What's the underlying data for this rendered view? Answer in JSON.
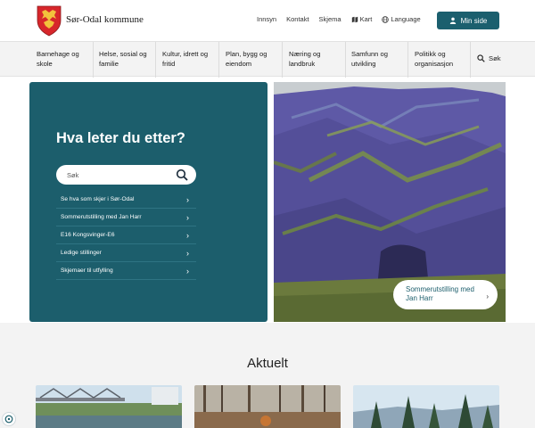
{
  "header": {
    "brand": "Sør-Odal kommune",
    "links": [
      {
        "label": "Innsyn"
      },
      {
        "label": "Kontakt"
      },
      {
        "label": "Skjema"
      },
      {
        "label": "Kart",
        "icon": "map-icon"
      },
      {
        "label": "Language",
        "icon": "globe-icon"
      }
    ],
    "my_page_label": "Min side"
  },
  "nav": {
    "items": [
      {
        "label": "Barnehage og skole"
      },
      {
        "label": "Helse, sosial og familie"
      },
      {
        "label": "Kultur, idrett og fritid"
      },
      {
        "label": "Plan, bygg og eiendom"
      },
      {
        "label": "Næring og landbruk"
      },
      {
        "label": "Samfunn og utvikling"
      },
      {
        "label": "Politikk og organisasjon"
      }
    ],
    "search_label": "Søk"
  },
  "hero": {
    "title": "Hva leter du etter?",
    "search_placeholder": "Søk",
    "quicklinks": [
      {
        "label": "Se hva som skjer i Sør-Odal"
      },
      {
        "label": "Sommerutstilling med Jan Harr"
      },
      {
        "label": "E16 Kongsvinger-E6"
      },
      {
        "label": "Ledige stillinger"
      },
      {
        "label": "Skjemaer til utfylling"
      }
    ],
    "featured_card": "Sommerutstilling med Jan Harr"
  },
  "news": {
    "title": "Aktuelt"
  },
  "colors": {
    "accent": "#1c5e6c",
    "button": "#1b5f6e",
    "nav_bg": "#f3f3f3"
  }
}
